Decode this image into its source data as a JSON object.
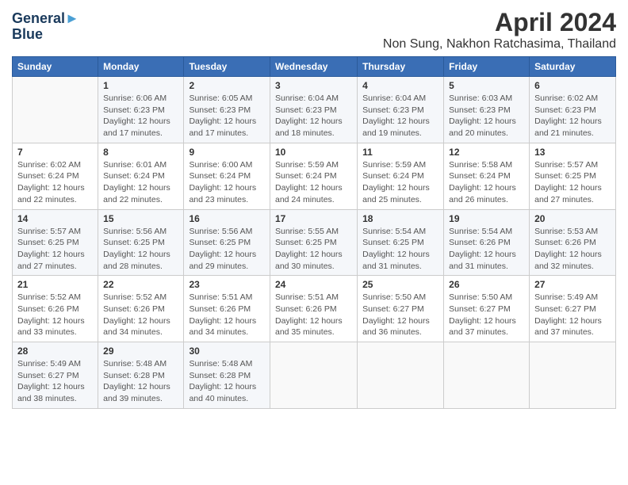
{
  "header": {
    "logo_line1": "General",
    "logo_line2": "Blue",
    "title": "April 2024",
    "subtitle": "Non Sung, Nakhon Ratchasima, Thailand"
  },
  "calendar": {
    "days_of_week": [
      "Sunday",
      "Monday",
      "Tuesday",
      "Wednesday",
      "Thursday",
      "Friday",
      "Saturday"
    ],
    "weeks": [
      [
        {
          "num": "",
          "info": ""
        },
        {
          "num": "1",
          "info": "Sunrise: 6:06 AM\nSunset: 6:23 PM\nDaylight: 12 hours\nand 17 minutes."
        },
        {
          "num": "2",
          "info": "Sunrise: 6:05 AM\nSunset: 6:23 PM\nDaylight: 12 hours\nand 17 minutes."
        },
        {
          "num": "3",
          "info": "Sunrise: 6:04 AM\nSunset: 6:23 PM\nDaylight: 12 hours\nand 18 minutes."
        },
        {
          "num": "4",
          "info": "Sunrise: 6:04 AM\nSunset: 6:23 PM\nDaylight: 12 hours\nand 19 minutes."
        },
        {
          "num": "5",
          "info": "Sunrise: 6:03 AM\nSunset: 6:23 PM\nDaylight: 12 hours\nand 20 minutes."
        },
        {
          "num": "6",
          "info": "Sunrise: 6:02 AM\nSunset: 6:23 PM\nDaylight: 12 hours\nand 21 minutes."
        }
      ],
      [
        {
          "num": "7",
          "info": "Sunrise: 6:02 AM\nSunset: 6:24 PM\nDaylight: 12 hours\nand 22 minutes."
        },
        {
          "num": "8",
          "info": "Sunrise: 6:01 AM\nSunset: 6:24 PM\nDaylight: 12 hours\nand 22 minutes."
        },
        {
          "num": "9",
          "info": "Sunrise: 6:00 AM\nSunset: 6:24 PM\nDaylight: 12 hours\nand 23 minutes."
        },
        {
          "num": "10",
          "info": "Sunrise: 5:59 AM\nSunset: 6:24 PM\nDaylight: 12 hours\nand 24 minutes."
        },
        {
          "num": "11",
          "info": "Sunrise: 5:59 AM\nSunset: 6:24 PM\nDaylight: 12 hours\nand 25 minutes."
        },
        {
          "num": "12",
          "info": "Sunrise: 5:58 AM\nSunset: 6:24 PM\nDaylight: 12 hours\nand 26 minutes."
        },
        {
          "num": "13",
          "info": "Sunrise: 5:57 AM\nSunset: 6:25 PM\nDaylight: 12 hours\nand 27 minutes."
        }
      ],
      [
        {
          "num": "14",
          "info": "Sunrise: 5:57 AM\nSunset: 6:25 PM\nDaylight: 12 hours\nand 27 minutes."
        },
        {
          "num": "15",
          "info": "Sunrise: 5:56 AM\nSunset: 6:25 PM\nDaylight: 12 hours\nand 28 minutes."
        },
        {
          "num": "16",
          "info": "Sunrise: 5:56 AM\nSunset: 6:25 PM\nDaylight: 12 hours\nand 29 minutes."
        },
        {
          "num": "17",
          "info": "Sunrise: 5:55 AM\nSunset: 6:25 PM\nDaylight: 12 hours\nand 30 minutes."
        },
        {
          "num": "18",
          "info": "Sunrise: 5:54 AM\nSunset: 6:25 PM\nDaylight: 12 hours\nand 31 minutes."
        },
        {
          "num": "19",
          "info": "Sunrise: 5:54 AM\nSunset: 6:26 PM\nDaylight: 12 hours\nand 31 minutes."
        },
        {
          "num": "20",
          "info": "Sunrise: 5:53 AM\nSunset: 6:26 PM\nDaylight: 12 hours\nand 32 minutes."
        }
      ],
      [
        {
          "num": "21",
          "info": "Sunrise: 5:52 AM\nSunset: 6:26 PM\nDaylight: 12 hours\nand 33 minutes."
        },
        {
          "num": "22",
          "info": "Sunrise: 5:52 AM\nSunset: 6:26 PM\nDaylight: 12 hours\nand 34 minutes."
        },
        {
          "num": "23",
          "info": "Sunrise: 5:51 AM\nSunset: 6:26 PM\nDaylight: 12 hours\nand 34 minutes."
        },
        {
          "num": "24",
          "info": "Sunrise: 5:51 AM\nSunset: 6:26 PM\nDaylight: 12 hours\nand 35 minutes."
        },
        {
          "num": "25",
          "info": "Sunrise: 5:50 AM\nSunset: 6:27 PM\nDaylight: 12 hours\nand 36 minutes."
        },
        {
          "num": "26",
          "info": "Sunrise: 5:50 AM\nSunset: 6:27 PM\nDaylight: 12 hours\nand 37 minutes."
        },
        {
          "num": "27",
          "info": "Sunrise: 5:49 AM\nSunset: 6:27 PM\nDaylight: 12 hours\nand 37 minutes."
        }
      ],
      [
        {
          "num": "28",
          "info": "Sunrise: 5:49 AM\nSunset: 6:27 PM\nDaylight: 12 hours\nand 38 minutes."
        },
        {
          "num": "29",
          "info": "Sunrise: 5:48 AM\nSunset: 6:28 PM\nDaylight: 12 hours\nand 39 minutes."
        },
        {
          "num": "30",
          "info": "Sunrise: 5:48 AM\nSunset: 6:28 PM\nDaylight: 12 hours\nand 40 minutes."
        },
        {
          "num": "",
          "info": ""
        },
        {
          "num": "",
          "info": ""
        },
        {
          "num": "",
          "info": ""
        },
        {
          "num": "",
          "info": ""
        }
      ]
    ]
  }
}
